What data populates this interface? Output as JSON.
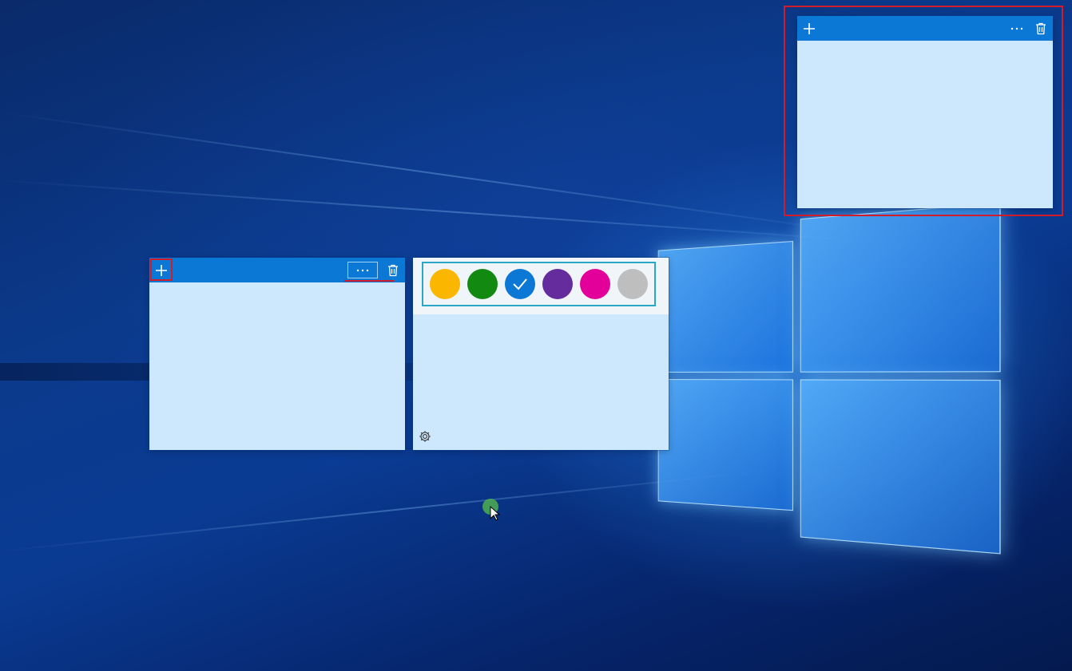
{
  "desktop": {
    "wallpaper": "windows-10-hero",
    "accent_color": "#0a78d4"
  },
  "notes": {
    "header_color": "#0a78d4",
    "body_color": "#cde8fc",
    "buttons": {
      "add_icon": "plus-icon",
      "menu_icon": "ellipsis-icon",
      "delete_icon": "trash-icon"
    }
  },
  "color_menu": {
    "selected": "blue",
    "swatches": [
      {
        "name": "yellow",
        "color": "#fbb600"
      },
      {
        "name": "green",
        "color": "#128a12"
      },
      {
        "name": "blue",
        "color": "#0a78d4"
      },
      {
        "name": "purple",
        "color": "#652c9e"
      },
      {
        "name": "pink",
        "color": "#e3009a"
      },
      {
        "name": "gray",
        "color": "#bebebe"
      }
    ],
    "settings_icon": "gear-icon"
  },
  "annotations": {
    "color": "#d21c2a"
  }
}
